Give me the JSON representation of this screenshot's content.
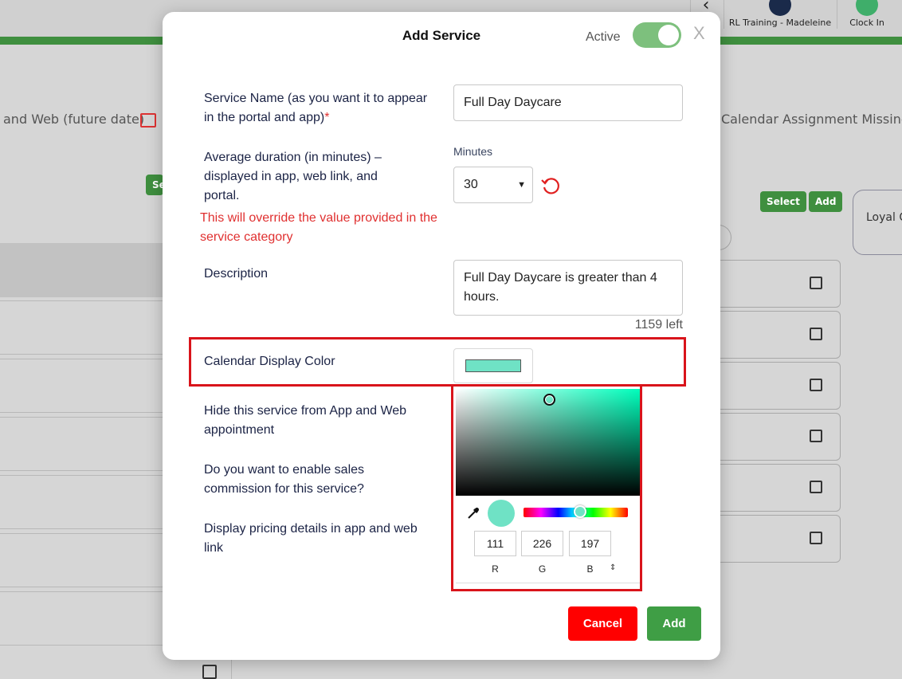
{
  "header": {
    "user_label": "RL Training - Madeleine",
    "clock_label": "Clock In"
  },
  "background": {
    "left_text": "and Web (future date)",
    "right_text": "Calendar Assignment Missing",
    "left_btn": "Se",
    "select_btn": "Select",
    "add_btn": "Add",
    "loyal_card": "Loyal C"
  },
  "modal": {
    "title": "Add Service",
    "active_label": "Active",
    "active_on": true,
    "close_label": "X",
    "service_name_label": "Service Name (as you want it to appear in the portal and app)",
    "required_marker": "*",
    "service_name_value": "Full Day Daycare",
    "duration_label": "Average duration (in minutes) – displayed in app, web link, and portal.",
    "duration_warning": "This will override the value provided in the service category",
    "minutes_label": "Minutes",
    "duration_value": "30",
    "description_label": "Description",
    "description_value": "Full Day Daycare is greater than 4 hours.",
    "chars_left": "1159 left",
    "color_label": "Calendar Display Color",
    "color_value": "#6fe2c5",
    "hide_label": "Hide this service from App and Web appointment",
    "commission_label": "Do you want to enable sales commission for this service?",
    "pricing_label": "Display pricing details in app and web link",
    "cancel_label": "Cancel",
    "add_label": "Add"
  },
  "picker": {
    "r": "111",
    "g": "226",
    "b": "197",
    "r_label": "R",
    "g_label": "G",
    "b_label": "B",
    "hue_color": "#00ffbc",
    "mode_icon": "up-down-arrows-icon"
  },
  "colors": {
    "brand_green": "#3f8f3f",
    "danger": "#ff0000",
    "highlight": "#d9141b"
  }
}
